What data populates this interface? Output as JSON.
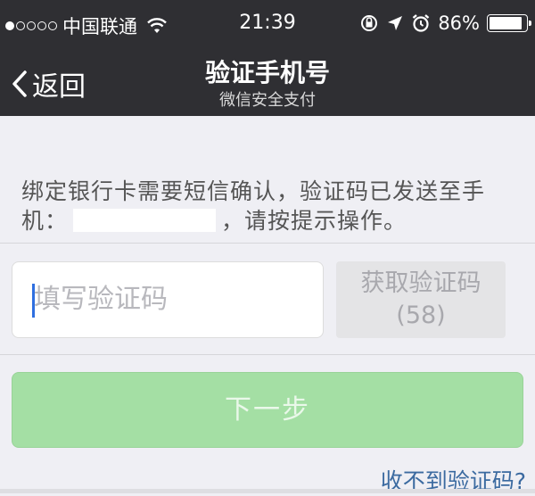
{
  "status_bar": {
    "carrier": "中国联通",
    "signal_filled": 1,
    "signal_total": 5,
    "time": "21:39",
    "battery": "86%"
  },
  "nav": {
    "back_label": "返回",
    "title": "验证手机号",
    "subtitle": "微信安全支付"
  },
  "main": {
    "desc_part1": "绑定银行卡需要短信确认，验证码已发送至手机：",
    "desc_part2": "，请按提示操作。",
    "code_placeholder": "填写验证码",
    "get_code_label": "获取验证码",
    "get_code_countdown": "(58)",
    "next_label": "下一步",
    "help_link": "收不到验证码?"
  },
  "colors": {
    "bar_bg": "#2f2f33",
    "page_bg": "#efeff4",
    "next_btn": "#a4dfa4",
    "link": "#3b6aa0",
    "caret": "#2f6fe0"
  }
}
